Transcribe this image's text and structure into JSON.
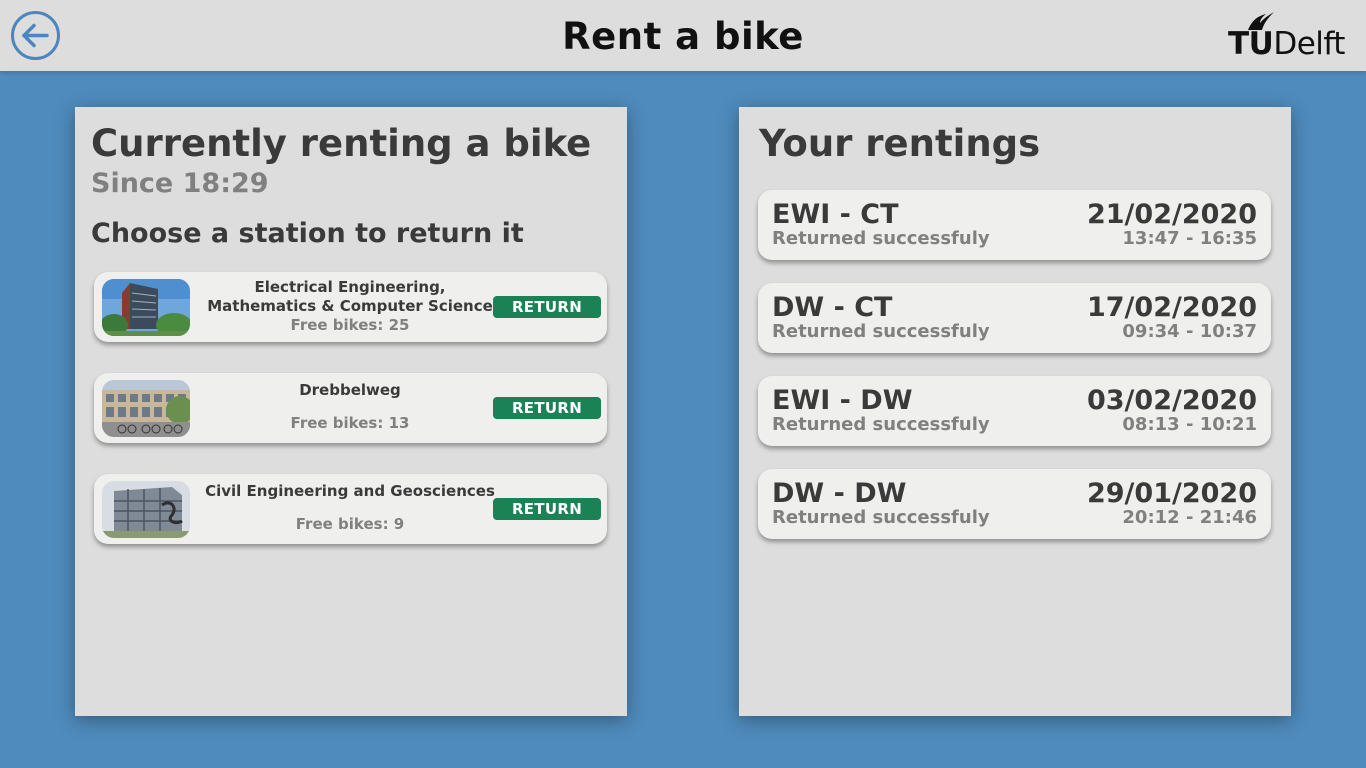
{
  "header": {
    "title": "Rent a bike",
    "back_icon": "arrow-left-circle-icon",
    "logo": {
      "tu": "TU",
      "delft": "Delft"
    }
  },
  "current": {
    "title": "Currently renting a bike",
    "since": "Since 18:29",
    "choose": "Choose a station to return it",
    "stations": [
      {
        "name": "Electrical Engineering, Mathematics & Computer Science",
        "free": "Free bikes: 25",
        "button": "RETURN"
      },
      {
        "name": "Drebbelweg",
        "free": "Free bikes: 13",
        "button": "RETURN"
      },
      {
        "name": "Civil Engineering and Geosciences",
        "free": "Free bikes: 9",
        "button": "RETURN"
      }
    ]
  },
  "rentings": {
    "title": "Your rentings",
    "items": [
      {
        "route": "EWI - CT",
        "status": "Returned successfuly",
        "date": "21/02/2020",
        "time": "13:47 - 16:35"
      },
      {
        "route": "DW - CT",
        "status": "Returned successfuly",
        "date": "17/02/2020",
        "time": "09:34 - 10:37"
      },
      {
        "route": "EWI - DW",
        "status": "Returned successfuly",
        "date": "03/02/2020",
        "time": "08:13 - 10:21"
      },
      {
        "route": "DW - DW",
        "status": "Returned successfuly",
        "date": "29/01/2020",
        "time": "20:12 - 21:46"
      }
    ]
  },
  "colors": {
    "background": "#4f8bbd",
    "panel": "#dddddd",
    "card": "#efefed",
    "return_button": "#1b8256",
    "back_icon": "#4a86c0"
  }
}
